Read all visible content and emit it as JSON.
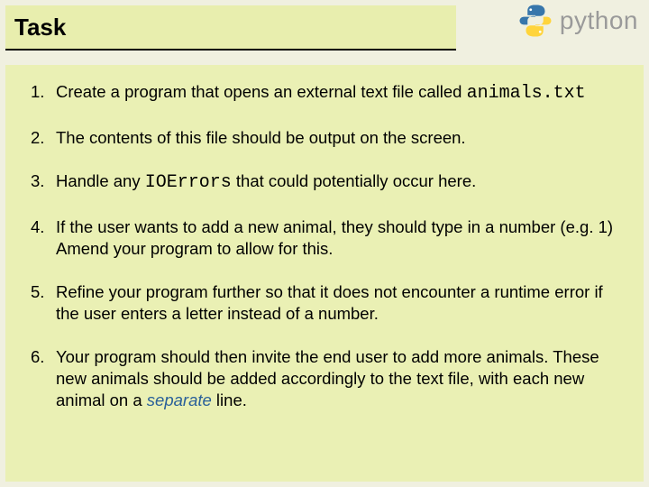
{
  "header": {
    "title": "Task",
    "logo_text": "python"
  },
  "tasks": {
    "item1_a": "Create a program that opens an external text file called ",
    "item1_code": "animals.txt",
    "item2": "The contents of this file should be output on the screen.",
    "item3_a": "Handle any ",
    "item3_code": "IOErrors",
    "item3_b": " that could potentially occur here.",
    "item4": "If the user wants to add a new animal, they should type in a number (e.g. 1) Amend your program to allow for this.",
    "item5": "Refine your program further so that it does not encounter a runtime error if the user enters a letter instead of a number.",
    "item6_a": "Your program should then invite the end user to add more animals. These new animals should be added accordingly to the text file, with each new animal on a ",
    "item6_em": "separate",
    "item6_b": " line."
  }
}
